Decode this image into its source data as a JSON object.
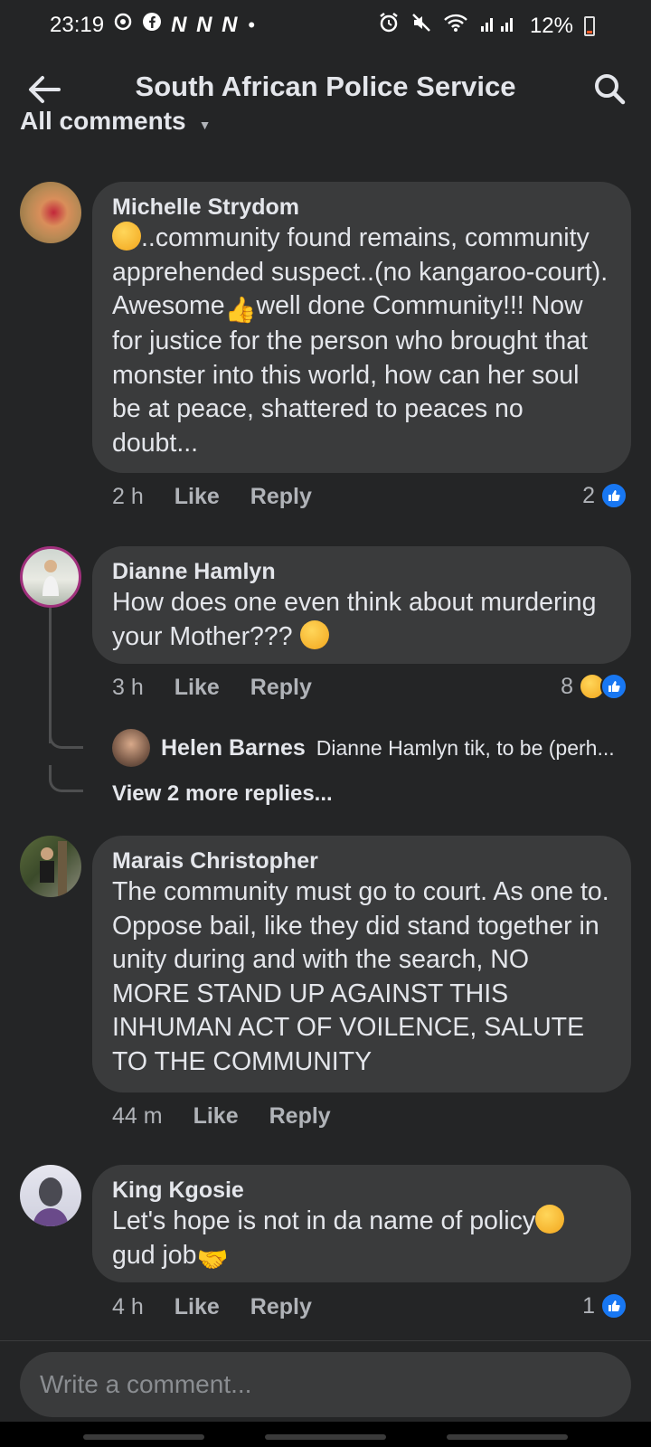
{
  "status_bar": {
    "time": "23:19",
    "app_glyphs": "N N N",
    "battery": "12%"
  },
  "header": {
    "title": "South African Police Service"
  },
  "sort": {
    "label": "All comments"
  },
  "comments": [
    {
      "author": "Michelle Strydom",
      "text_1": "..community found remains, community apprehended suspect..(no kangaroo-court). Awesome",
      "text_2": "well done Community!!! Now for justice for the person who brought that monster into this world, how can her soul be at peace, shattered to peaces no doubt...",
      "time": "2 h",
      "like_label": "Like",
      "reply_label": "Reply",
      "reaction_count": "2"
    },
    {
      "author": "Dianne Hamlyn",
      "text_1": "How does one even think about murdering your Mother???",
      "time": "3 h",
      "like_label": "Like",
      "reply_label": "Reply",
      "reaction_count": "8"
    },
    {
      "author": "Marais Christopher",
      "text_1": "The community must go to court. As one to. Oppose bail, like they did stand together in unity during and with the search, NO MORE STAND UP AGAINST THIS INHUMAN ACT OF VOILENCE, SALUTE TO THE COMMUNITY",
      "time": "44 m",
      "like_label": "Like",
      "reply_label": "Reply"
    },
    {
      "author": "King Kgosie",
      "text_1": "Let's hope is not in da name of policy",
      "text_2": "gud job",
      "time": "4 h",
      "like_label": "Like",
      "reply_label": "Reply",
      "reaction_count": "1"
    }
  ],
  "reply_preview": {
    "author": "Helen Barnes",
    "text": "Dianne Hamlyn tik, to be (perh..."
  },
  "view_more": "View 2 more replies...",
  "composer": {
    "placeholder": "Write a comment..."
  },
  "colors": {
    "background": "#242526",
    "bubble": "#3a3b3c",
    "accent_like": "#1877f2",
    "secondary_text": "#b0b3b8"
  }
}
